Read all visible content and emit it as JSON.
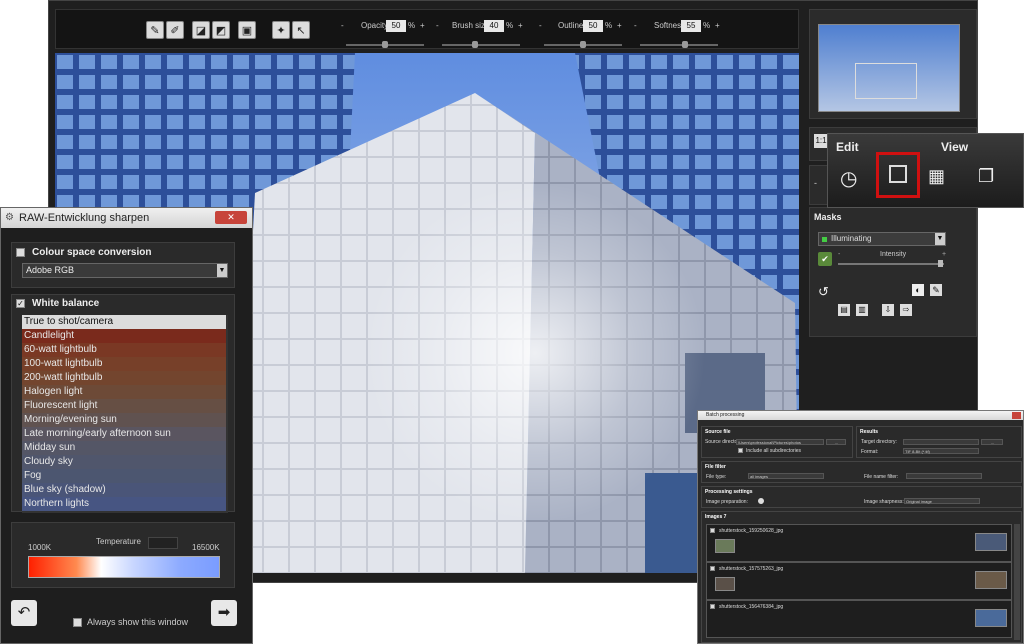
{
  "toolbar": {
    "sliders": [
      {
        "label": "Opacity",
        "value": "50",
        "unit": "%",
        "minus": "-",
        "plus": "+"
      },
      {
        "label": "Brush size",
        "value": "40",
        "unit": "%",
        "minus": "-",
        "plus": "+"
      },
      {
        "label": "Outlines",
        "value": "50",
        "unit": "%",
        "minus": "-",
        "plus": "+"
      },
      {
        "label": "Softness",
        "value": "55",
        "unit": "%",
        "minus": "-",
        "plus": "+"
      }
    ]
  },
  "right": {
    "zoom_label": "1:1",
    "masks_title": "Masks",
    "mask_select": "Illuminating",
    "intensity_label": "Intensity",
    "minus": "-",
    "plus": "+"
  },
  "popup": {
    "edit_label": "Edit",
    "view_label": "View"
  },
  "raw": {
    "title": "RAW-Entwicklung sharpen",
    "close": "✕",
    "colour_space_label": "Colour space conversion",
    "colour_space_value": "Adobe RGB",
    "white_balance_label": "White balance",
    "wb_items": [
      "True to shot/camera",
      "Candlelight",
      "60-watt lightbulb",
      "100-watt lightbulb",
      "200-watt lightbulb",
      "Halogen light",
      "Fluorescent light",
      "Morning/evening sun",
      "Late morning/early afternoon sun",
      "Midday sun",
      "Cloudy sky",
      "Fog",
      "Blue sky (shadow)",
      "Northern lights"
    ],
    "wb_colors": [
      "#dcdcdc",
      "#7a2a1c",
      "#7a3824",
      "#774029",
      "#73452e",
      "#6d4a37",
      "#664f44",
      "#605250",
      "#5a5560",
      "#545666",
      "#50566c",
      "#4c5670",
      "#4a5578",
      "#475582"
    ],
    "temp_min": "1000K",
    "temp_label": "Temperature",
    "temp_max": "16500K",
    "always_show": "Always show this window"
  },
  "batch": {
    "title": "Batch processing",
    "source_file": "Source file",
    "source_dir_label": "Source directory:",
    "source_dir_value": "\\Users\\professional\\Pictures\\photos",
    "include_sub": "Include all subdirectories",
    "results": "Results",
    "target_dir_label": "Target directory:",
    "format_label": "Format:",
    "format_value": "TIF 8-Bit (*.tif)",
    "file_filter": "File filter",
    "file_type_label": "File type:",
    "file_type_value": "all images",
    "file_name_filter_label": "File name filter:",
    "processing_settings": "Processing settings",
    "image_prep_label": "Image preparation:",
    "image_sharpness_label": "Image sharpness:",
    "image_sharpness_value": "Original image",
    "images_label": "Images 7",
    "browse": "...",
    "images": [
      "shutterstock_159250628_jpg",
      "shutterstock_157575263_jpg",
      "shutterstock_156476384_jpg"
    ]
  }
}
